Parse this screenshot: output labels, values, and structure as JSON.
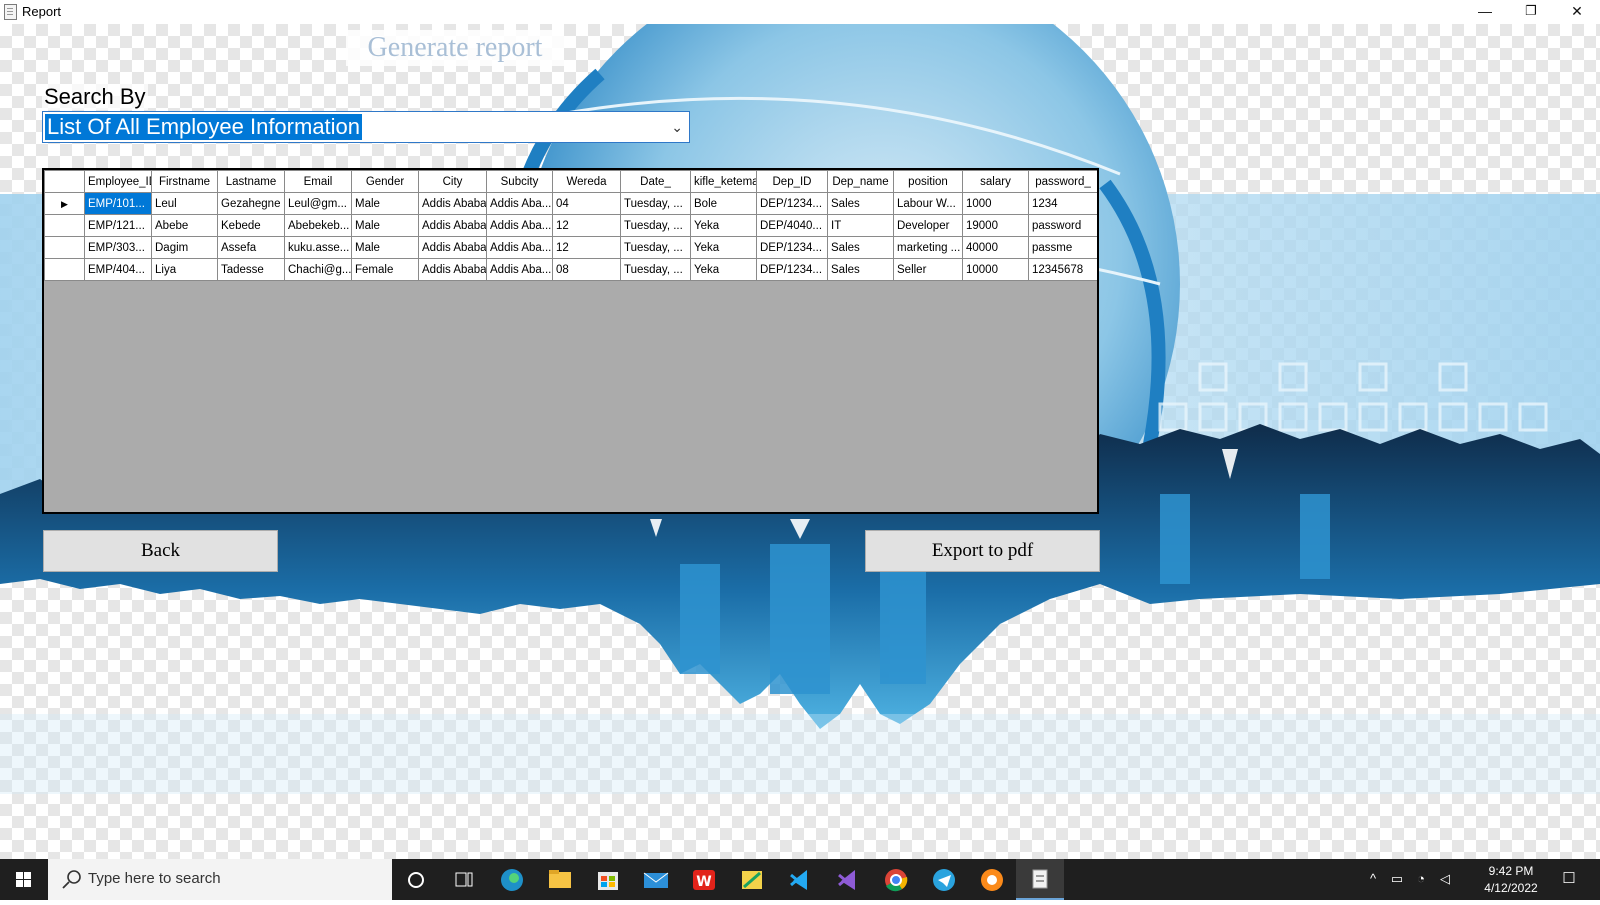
{
  "window": {
    "title": "Report",
    "controls": {
      "minimize": "—",
      "restore": "❐",
      "close": "✕"
    }
  },
  "form": {
    "heading": "Generate report",
    "search_label": "Search By",
    "search_selected": "List Of All Employee Information"
  },
  "grid": {
    "columns": [
      "Employee_ID",
      "Firstname",
      "Lastname",
      "Email",
      "Gender",
      "City",
      "Subcity",
      "Wereda",
      "Date_",
      "kifle_ketema",
      "Dep_ID",
      "Dep_name",
      "position",
      "salary",
      "password_"
    ],
    "rows": [
      [
        "EMP/101...",
        "Leul",
        "Gezahegne",
        "Leul@gm...",
        "Male",
        "Addis Ababa",
        "Addis Aba...",
        "04",
        "Tuesday, ...",
        "Bole",
        "DEP/1234...",
        "Sales",
        "Labour W...",
        "1000",
        "1234"
      ],
      [
        "EMP/121...",
        "Abebe",
        "Kebede",
        "Abebekeb...",
        "Male",
        "Addis Ababa",
        "Addis Aba...",
        "12",
        "Tuesday, ...",
        "Yeka",
        "DEP/4040...",
        "IT",
        "Developer",
        "19000",
        "password"
      ],
      [
        "EMP/303...",
        "Dagim",
        "Assefa",
        "kuku.asse...",
        "Male",
        "Addis Ababa",
        "Addis Aba...",
        "12",
        "Tuesday, ...",
        "Yeka",
        "DEP/1234...",
        "Sales",
        "marketing ...",
        "40000",
        "passme"
      ],
      [
        "EMP/404...",
        "Liya",
        "Tadesse",
        "Chachi@g...",
        "Female",
        "Addis Ababa",
        "Addis Aba...",
        "08",
        "Tuesday, ...",
        "Yeka",
        "DEP/1234...",
        "Sales",
        "Seller",
        "10000",
        "12345678"
      ]
    ],
    "current_row_marker": "▶"
  },
  "buttons": {
    "back": "Back",
    "export": "Export to pdf"
  },
  "taskbar": {
    "search_placeholder": "Type here to search",
    "apps": [
      "cortana-icon",
      "task-view-icon",
      "edge-icon",
      "file-explorer-icon",
      "store-icon",
      "mail-icon",
      "wps-office-icon",
      "app-icon",
      "vscode-icon",
      "visual-studio-icon",
      "chrome-icon",
      "telegram-icon",
      "brave-icon",
      "report-app-icon"
    ],
    "time": "9:42 PM",
    "date": "4/12/2022"
  },
  "colors": {
    "accent": "#0078d7",
    "heading_text": "#a9bfd6",
    "grid_background": "#ababab"
  }
}
